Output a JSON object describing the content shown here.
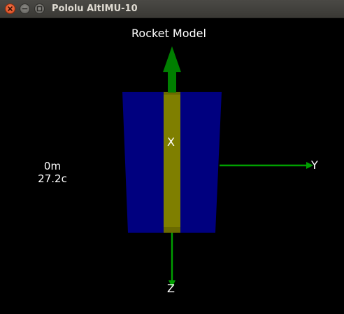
{
  "window": {
    "title": "Pololu AltIMU-10"
  },
  "scene": {
    "heading": "Rocket Model",
    "altitude": "0m",
    "temperature": "27.2c",
    "axes": {
      "x_label": "X",
      "y_label": "Y",
      "z_label": "Z"
    },
    "colors": {
      "background": "#000000",
      "rocket_body": "#00007f",
      "rocket_spine": "#7f7f00",
      "axis_arrow": "#007f00"
    }
  }
}
